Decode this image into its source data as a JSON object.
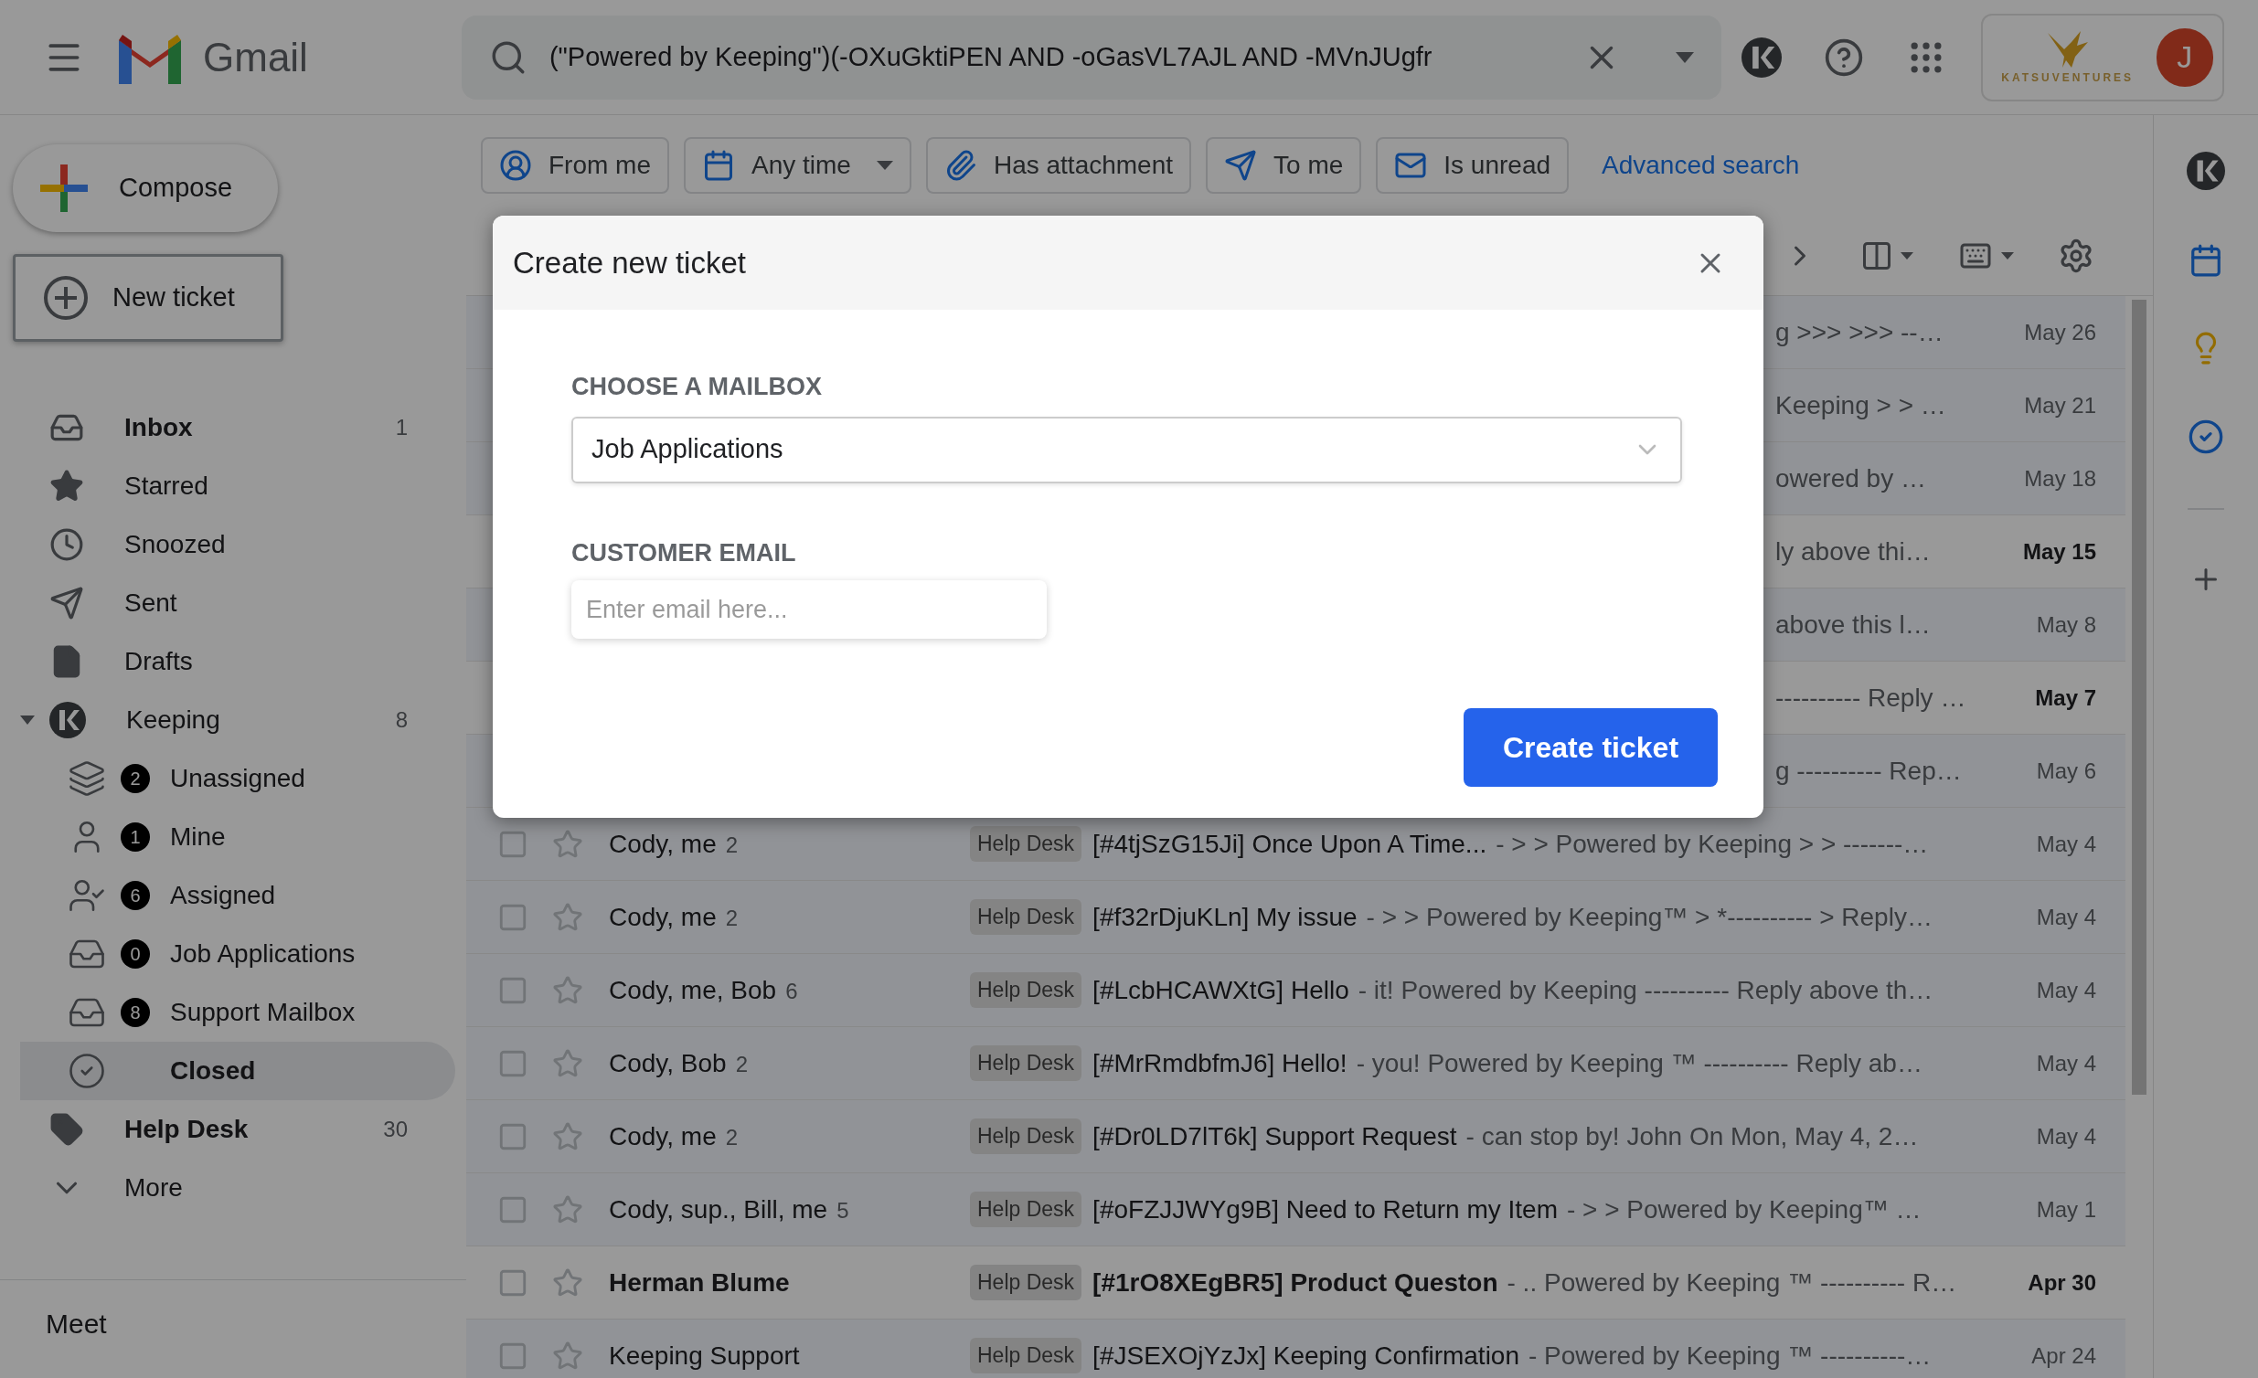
{
  "header": {
    "app_name": "Gmail",
    "search": {
      "value": "(\"Powered by Keeping\")(-OXuGktiPEN AND -oGasVL7AJL AND -MVnJUgfr"
    },
    "account_brand": "KATSUVENTURES",
    "avatar_letter": "J"
  },
  "sidebar": {
    "compose": "Compose",
    "new_ticket": "New ticket",
    "items": [
      {
        "label": "Inbox",
        "count": "1",
        "unread": true,
        "selected": false
      },
      {
        "label": "Starred",
        "unread": false,
        "selected": false
      },
      {
        "label": "Snoozed",
        "unread": false,
        "selected": false
      },
      {
        "label": "Sent",
        "unread": false,
        "selected": false
      },
      {
        "label": "Drafts",
        "unread": false,
        "selected": false
      },
      {
        "label": "Keeping",
        "count": "8",
        "unread": false,
        "selected": false,
        "expanded": true,
        "children": [
          {
            "label": "Unassigned",
            "badge": "2",
            "selected": false
          },
          {
            "label": "Mine",
            "badge": "1",
            "selected": false
          },
          {
            "label": "Assigned",
            "badge": "6",
            "selected": false
          },
          {
            "label": "Job Applications",
            "badge": "0",
            "selected": false
          },
          {
            "label": "Support Mailbox",
            "badge": "8",
            "selected": false
          },
          {
            "label": "Closed",
            "selected": true
          }
        ]
      },
      {
        "label": "Help Desk",
        "count": "30",
        "unread": true,
        "selected": false
      },
      {
        "label": "More",
        "unread": false,
        "selected": false
      }
    ],
    "meet": "Meet"
  },
  "filters": {
    "chips": [
      {
        "label": "From me",
        "dropdown": false
      },
      {
        "label": "Any time",
        "dropdown": true
      },
      {
        "label": "Has attachment",
        "dropdown": false
      },
      {
        "label": "To me",
        "dropdown": false
      },
      {
        "label": "Is unread",
        "dropdown": false
      }
    ],
    "advanced_search": "Advanced search"
  },
  "rows": [
    {
      "kind": "covered",
      "visible_text": "g >>> >>> --…",
      "date": "May 26",
      "unread": false
    },
    {
      "kind": "covered",
      "visible_text": "Keeping > > …",
      "date": "May 21",
      "unread": false
    },
    {
      "kind": "covered",
      "visible_text": "owered by …",
      "date": "May 18",
      "unread": false
    },
    {
      "kind": "covered",
      "visible_text": "ly above thi…",
      "date": "May 15",
      "unread": true
    },
    {
      "kind": "covered",
      "visible_text": "above this l…",
      "date": "May 8",
      "unread": false
    },
    {
      "kind": "covered",
      "visible_text": "---------- Reply …",
      "date": "May 7",
      "unread": true
    },
    {
      "kind": "covered",
      "visible_text": "g ---------- Rep…",
      "date": "May 6",
      "unread": false
    },
    {
      "kind": "full",
      "sender": "Cody, me",
      "count": "2",
      "label": "Help Desk",
      "subject": "[#4tjSzG15Ji] Once Upon A Time...",
      "snippet": "- > > Powered by Keeping > > -------…",
      "date": "May 4",
      "unread": false
    },
    {
      "kind": "full",
      "sender": "Cody, me",
      "count": "2",
      "label": "Help Desk",
      "subject": "[#f32rDjuKLn] My issue",
      "snippet": "- > > Powered by Keeping™ > *---------- > Reply…",
      "date": "May 4",
      "unread": false
    },
    {
      "kind": "full",
      "sender": "Cody, me, Bob",
      "count": "6",
      "label": "Help Desk",
      "subject": "[#LcbHCAWXtG] Hello",
      "snippet": "- it! Powered by Keeping ---------- Reply above th…",
      "date": "May 4",
      "unread": false
    },
    {
      "kind": "full",
      "sender": "Cody, Bob",
      "count": "2",
      "label": "Help Desk",
      "subject": "[#MrRmdbfmJ6] Hello!",
      "snippet": "- you! Powered by Keeping ™ ---------- Reply ab…",
      "date": "May 4",
      "unread": false
    },
    {
      "kind": "full",
      "sender": "Cody, me",
      "count": "2",
      "label": "Help Desk",
      "subject": "[#Dr0LD7lT6k] Support Request",
      "snippet": "- can stop by! John On Mon, May 4, 2…",
      "date": "May 4",
      "unread": false
    },
    {
      "kind": "full",
      "sender": "Cody, sup., Bill, me",
      "count": "5",
      "label": "Help Desk",
      "subject": "[#oFZJJWYg9B] Need to Return my Item",
      "snippet": "- > > Powered by Keeping™ …",
      "date": "May 1",
      "unread": false
    },
    {
      "kind": "full",
      "sender": "Herman Blume",
      "label": "Help Desk",
      "subject": "[#1rO8XEgBR5] Product Queston",
      "snippet": "- .. Powered by Keeping ™ ---------- R…",
      "date": "Apr 30",
      "unread": true
    },
    {
      "kind": "full",
      "sender": "Keeping Support",
      "label": "Help Desk",
      "subject": "[#JSEXOjYzJx] Keeping Confirmation",
      "snippet": "- Powered by Keeping ™ ----------…",
      "date": "Apr 24",
      "unread": false
    }
  ],
  "dialog": {
    "title": "Create new ticket",
    "mailbox_label": "CHOOSE A MAILBOX",
    "mailbox_value": "Job Applications",
    "email_label": "CUSTOMER EMAIL",
    "email_placeholder": "Enter email here...",
    "submit": "Create ticket"
  }
}
